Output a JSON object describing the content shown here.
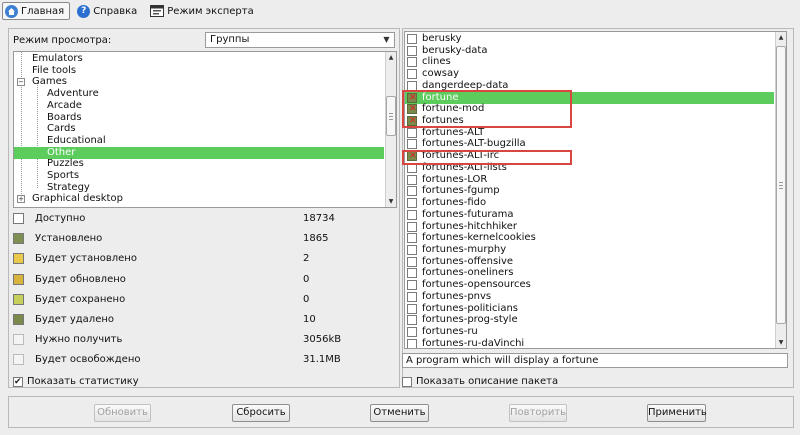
{
  "toolbar": {
    "home_label": "Главная",
    "help_label": "Справка",
    "expert_label": "Режим эксперта"
  },
  "view": {
    "label": "Режим просмотра:",
    "selected": "Группы"
  },
  "tree": {
    "items": [
      {
        "label": "Emulators"
      },
      {
        "label": "File tools"
      },
      {
        "label": "Games",
        "toggle": "−"
      },
      {
        "label": "Adventure"
      },
      {
        "label": "Arcade"
      },
      {
        "label": "Boards"
      },
      {
        "label": "Cards"
      },
      {
        "label": "Educational"
      },
      {
        "label": "Other",
        "selected": true
      },
      {
        "label": "Puzzles"
      },
      {
        "label": "Sports"
      },
      {
        "label": "Strategy"
      },
      {
        "label": "Graphical desktop",
        "toggle": "+"
      }
    ]
  },
  "stats": [
    {
      "label": "Доступно",
      "value": "18734",
      "icon": "available-icon"
    },
    {
      "label": "Установлено",
      "value": "1865",
      "icon": "installed-icon"
    },
    {
      "label": "Будет установлено",
      "value": "2",
      "icon": "to-install-icon"
    },
    {
      "label": "Будет обновлено",
      "value": "0",
      "icon": "to-upgrade-icon"
    },
    {
      "label": "Будет сохранено",
      "value": "0",
      "icon": "to-keep-icon"
    },
    {
      "label": "Будет удалено",
      "value": "10",
      "icon": "to-remove-icon"
    },
    {
      "label": "Нужно получить",
      "value": "3056kB",
      "icon": "download-icon"
    },
    {
      "label": "Будет освобождено",
      "value": "31.1MB",
      "icon": "free-space-icon"
    }
  ],
  "show_stats": {
    "label": "Показать статистику",
    "checked": true
  },
  "packages": [
    {
      "name": "berusky",
      "state": "none"
    },
    {
      "name": "berusky-data",
      "state": "none"
    },
    {
      "name": "clines",
      "state": "none"
    },
    {
      "name": "cowsay",
      "state": "none"
    },
    {
      "name": "dangerdeep-data",
      "state": "none"
    },
    {
      "name": "fortune",
      "state": "remove",
      "selected": true
    },
    {
      "name": "fortune-mod",
      "state": "remove"
    },
    {
      "name": "fortunes",
      "state": "remove"
    },
    {
      "name": "fortunes-ALT",
      "state": "none"
    },
    {
      "name": "fortunes-ALT-bugzilla",
      "state": "none"
    },
    {
      "name": "fortunes-ALT-irc",
      "state": "remove"
    },
    {
      "name": "fortunes-ALT-lists",
      "state": "none"
    },
    {
      "name": "fortunes-LOR",
      "state": "none"
    },
    {
      "name": "fortunes-fgump",
      "state": "none"
    },
    {
      "name": "fortunes-fido",
      "state": "none"
    },
    {
      "name": "fortunes-futurama",
      "state": "none"
    },
    {
      "name": "fortunes-hitchhiker",
      "state": "none"
    },
    {
      "name": "fortunes-kernelcookies",
      "state": "none"
    },
    {
      "name": "fortunes-murphy",
      "state": "none"
    },
    {
      "name": "fortunes-offensive",
      "state": "none"
    },
    {
      "name": "fortunes-oneliners",
      "state": "none"
    },
    {
      "name": "fortunes-opensources",
      "state": "none"
    },
    {
      "name": "fortunes-pnvs",
      "state": "none"
    },
    {
      "name": "fortunes-politicians",
      "state": "none"
    },
    {
      "name": "fortunes-prog-style",
      "state": "none"
    },
    {
      "name": "fortunes-ru",
      "state": "none"
    },
    {
      "name": "fortunes-ru-daVinchi",
      "state": "none"
    }
  ],
  "description": "A program which will display a fortune",
  "show_description": {
    "label": "Показать описание пакета",
    "checked": false
  },
  "buttons": {
    "update": "Обновить",
    "reset": "Сбросить",
    "cancel": "Отменить",
    "retry": "Повторить",
    "apply": "Применить"
  },
  "colors": {
    "selection": "#5ccc5c",
    "highlight_box": "#d9463f"
  }
}
